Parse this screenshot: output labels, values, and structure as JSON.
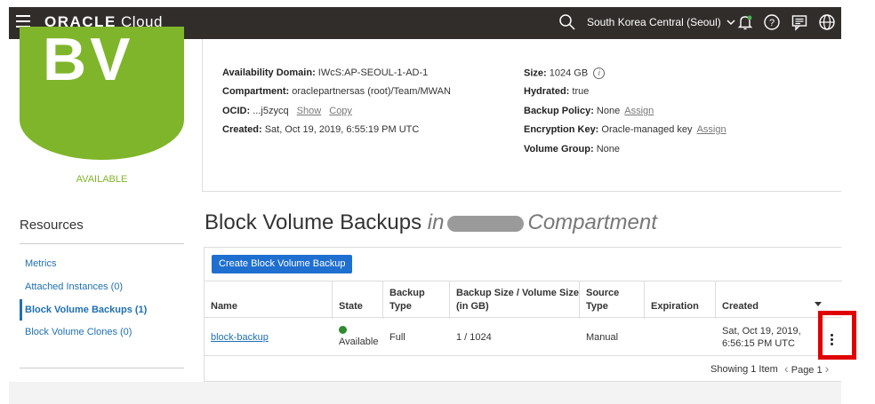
{
  "topbar": {
    "logo_brand": "ORACLE",
    "logo_product": "Cloud",
    "region": "South Korea Central (Seoul)",
    "icons": [
      "hamburger-icon",
      "search-icon",
      "chevron-down-icon",
      "bell-icon",
      "help-icon",
      "chat-icon",
      "globe-icon"
    ]
  },
  "volume": {
    "logo_text": "BV",
    "status": "AVAILABLE"
  },
  "details": {
    "availability_domain_label": "Availability Domain:",
    "availability_domain_value": "IWcS:AP-SEOUL-1-AD-1",
    "compartment_label": "Compartment:",
    "compartment_value": "oraclepartnersas (root)/Team/MWAN",
    "ocid_label": "OCID:",
    "ocid_value": "...j5zycq",
    "ocid_show": "Show",
    "ocid_copy": "Copy",
    "created_label": "Created:",
    "created_value": "Sat, Oct 19, 2019, 6:55:19 PM UTC",
    "size_label": "Size:",
    "size_value": "1024 GB",
    "hydrated_label": "Hydrated:",
    "hydrated_value": "true",
    "backup_policy_label": "Backup Policy:",
    "backup_policy_value": "None",
    "backup_policy_assign": "Assign",
    "encryption_key_label": "Encryption Key:",
    "encryption_key_value": "Oracle-managed key",
    "encryption_key_assign": "Assign",
    "volume_group_label": "Volume Group:",
    "volume_group_value": "None"
  },
  "resources": {
    "title": "Resources",
    "items": [
      {
        "label": "Metrics"
      },
      {
        "label": "Attached Instances (0)"
      },
      {
        "label": "Block Volume Backups (1)"
      },
      {
        "label": "Block Volume Clones (0)"
      }
    ]
  },
  "section": {
    "title": "Block Volume Backups",
    "in_text": "in",
    "compartment_text": "Compartment",
    "create_button": "Create Block Volume Backup"
  },
  "table": {
    "columns": [
      "Name",
      "State",
      "Backup Type",
      "Backup Size / Volume Size (in GB)",
      "Source Type",
      "Expiration",
      "Created"
    ],
    "columns_split": {
      "backup_type_1": "Backup",
      "backup_type_2": "Type",
      "size_1": "Backup Size / Volume Size",
      "size_2": "(in GB)",
      "source_1": "Source",
      "source_2": "Type"
    },
    "rows": [
      {
        "name": "block-backup",
        "state": "Available",
        "backup_type": "Full",
        "size": "1 / 1024",
        "source_type": "Manual",
        "expiration": "",
        "created_1": "Sat, Oct 19, 2019,",
        "created_2": "6:56:15 PM UTC"
      }
    ],
    "showing": "Showing 1 Item",
    "page": "Page 1"
  },
  "colors": {
    "topbar": "#312d2a",
    "accent_green": "#7fb52a",
    "link_blue": "#1f6fb2",
    "button_blue": "#1f6fd0",
    "highlight_red": "#e00000"
  }
}
